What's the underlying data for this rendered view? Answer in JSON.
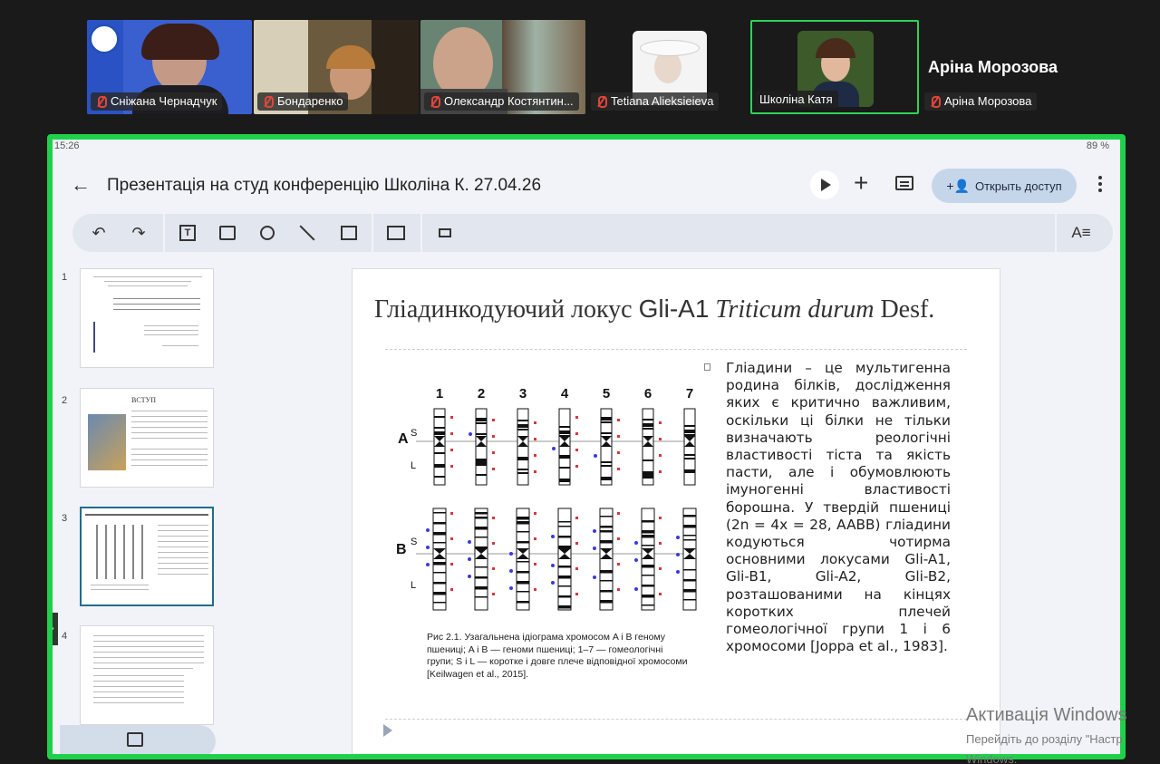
{
  "participants": [
    {
      "name": "Сніжана Чернадчук",
      "muted": true
    },
    {
      "name": "Бондаренко",
      "muted": true
    },
    {
      "name": "Олександр Костянтин...",
      "muted": true
    },
    {
      "name": "Tetiana Alieksieieva",
      "muted": true
    },
    {
      "name": "Школіна Катя",
      "muted": false,
      "active_speaker": true
    },
    {
      "name": "Аріна Морозова",
      "muted": true
    }
  ],
  "host_display_name": "Аріна Морозова",
  "device_status": {
    "time": "15:26",
    "battery": "89 %"
  },
  "editor": {
    "back_icon": "arrow-left-icon",
    "title": "Презентація на студ конференцію Школіна К. 27.04.26",
    "share_label": "Открыть доступ",
    "toolbar_icons": [
      "undo-icon",
      "redo-icon",
      "text-box-icon",
      "image-icon",
      "shapes-icon",
      "line-icon",
      "table-icon",
      "layout-icon",
      "format-paint-icon",
      "text-format-icon"
    ]
  },
  "thumbnails": [
    {
      "number": "1"
    },
    {
      "number": "2",
      "heading": "ВСТУП"
    },
    {
      "number": "3",
      "selected": true
    },
    {
      "number": "4"
    }
  ],
  "slide": {
    "title_part1": "Гліадинкодуючий локус ",
    "title_part2": "Gli-A1",
    "title_part3": " Triticum durum",
    "title_part4": " Desf.",
    "body": "Гліадини – це мультигенна родина білків, дослідження яких є критично важливим, оскільки ці білки не тільки визначають реологічні властивості тіста та якість пасти, але і обумовлюють імуногенні властивості борошна. У твердій пшениці (2n = 4x = 28, AABB) гліадини кодуються чотирма основними локусами Gli-A1, Gli-B1, Gli-A2, Gli-B2, розташованими на кінцях коротких плечей гомеологічної групи 1 і 6 хромосоми [Joppa et al., 1983].",
    "caption": "Рис 2.1. Узагальнена ідіограма хромосом A і B геному пшениці; A і B — геноми пшениці; 1–7 — гомеологічні групи; S і L — коротке і довге плече відповідної хромосоми [Keilwagen et al., 2015].",
    "idiogram": {
      "columns": [
        "1",
        "2",
        "3",
        "4",
        "5",
        "6",
        "7"
      ],
      "genome_a": "A",
      "genome_b": "B",
      "arm_short": "S",
      "arm_long": "L"
    }
  },
  "windows_watermark": {
    "line1": "Активація Windows",
    "line2": "Перейдіть до розділу \"Настр",
    "line3": "Windows."
  }
}
